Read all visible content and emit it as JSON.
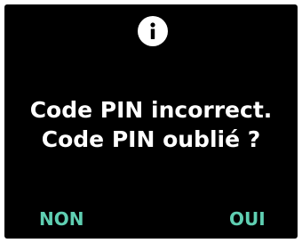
{
  "dialog": {
    "icon": "info-icon",
    "message_line1": "Code PIN incorrect.",
    "message_line2": "Code PIN oublié ?",
    "no_label": "NON",
    "yes_label": "OUI"
  },
  "colors": {
    "background": "#000000",
    "text": "#ffffff",
    "accent": "#5fcfb2"
  }
}
